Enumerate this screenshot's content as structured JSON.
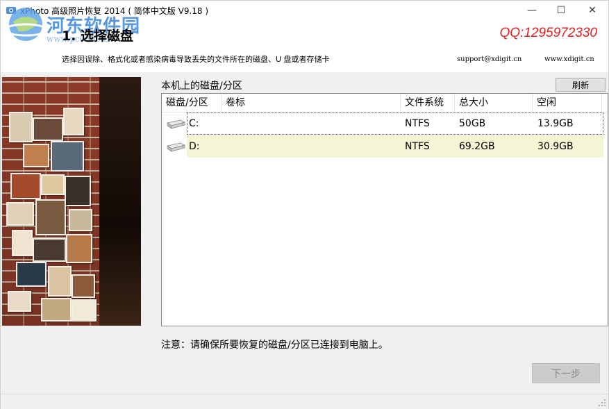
{
  "window": {
    "title": "xPhoto 高级照片恢复 2014 ( 简体中文版 V9.18 )",
    "min_glyph": "—",
    "max_glyph": "☐",
    "close_glyph": "✕"
  },
  "watermark": {
    "text": "河东软件园",
    "url": "www.pc0359.cn"
  },
  "header": {
    "step_title": "1. 选择磁盘",
    "description": "选择因误除、格式化或者感染病毒导致丢失的文件所在的磁盘、U 盘或者存储卡",
    "qq": "QQ:1295972330",
    "support_email": "support@xdigit.cn",
    "website": "www.xdigit.cn",
    "qq_color": "#e02020"
  },
  "disks": {
    "label": "本机上的磁盘/分区",
    "refresh_label": "刷新",
    "columns": [
      "磁盘/分区",
      "卷标",
      "文件系统",
      "总大小",
      "空闲"
    ],
    "rows": [
      {
        "drive": "C:",
        "volume": "",
        "fs": "NTFS",
        "total": "50GB",
        "free": "13.9GB"
      },
      {
        "drive": "D:",
        "volume": "",
        "fs": "NTFS",
        "total": "69.2GB",
        "free": "30.9GB"
      }
    ],
    "highlight_color": "#f5f5d6"
  },
  "footer": {
    "note": "注意：请确保所要恢复的磁盘/分区已连接到电脑上。",
    "next_label": "下一步"
  }
}
